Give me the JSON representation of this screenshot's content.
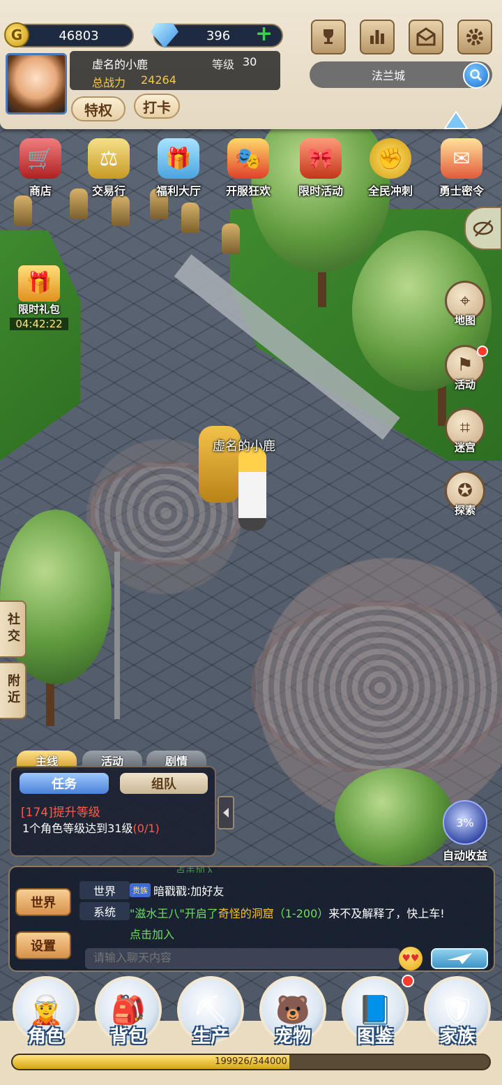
{
  "currency": {
    "gold": "46803",
    "gems": "396"
  },
  "player": {
    "name": "虚名的小鹿",
    "level_label": "等级",
    "level": "30",
    "power_label": "总战力",
    "power": "24264"
  },
  "top_buttons": {
    "privilege": "特权",
    "checkin": "打卡"
  },
  "location": "法兰城",
  "activities": [
    "商店",
    "交易行",
    "福利大厅",
    "开服狂欢",
    "限时活动",
    "全民冲刺",
    "勇士密令"
  ],
  "gift": {
    "label": "限时礼包",
    "timer": "04:42:22"
  },
  "right_menu": [
    "地图",
    "活动",
    "迷宫",
    "探索"
  ],
  "character_name": "虚名的小鹿",
  "side_tabs": [
    "社交",
    "附近"
  ],
  "quest_tabs": [
    "主线",
    "活动",
    "剧情"
  ],
  "quest_panel": {
    "task_tab": "任务",
    "team_tab": "组队",
    "title": "[174]提升等级",
    "desc": "1个角色等级达到31级",
    "progress": "(0/1)"
  },
  "auto_income": {
    "label": "自动收益",
    "percent": "3%"
  },
  "chat": {
    "world_btn": "世界",
    "settings_btn": "设置",
    "partial_line": "点击加入",
    "messages": [
      {
        "channel": "世界",
        "badge": "贵族",
        "sender": "暗戳戳",
        "text": "加好友"
      },
      {
        "channel": "系统",
        "text_pre": "\"滋水王八\"开启了",
        "highlight": "奇怪的洞窟",
        "range": "（1-200）",
        "text_post": "来不及解释了，快上车!",
        "join": "点击加入"
      }
    ],
    "input_placeholder": "请输入聊天内容"
  },
  "bottom_nav": [
    "角色",
    "背包",
    "生产",
    "宠物",
    "图鉴",
    "家族"
  ],
  "experience": {
    "text": "199926/344000",
    "fraction": 0.581
  },
  "colors": {
    "accent_red": "#ff5a4a",
    "system_green": "#6ee05a",
    "highlight_orange": "#f1c232"
  }
}
